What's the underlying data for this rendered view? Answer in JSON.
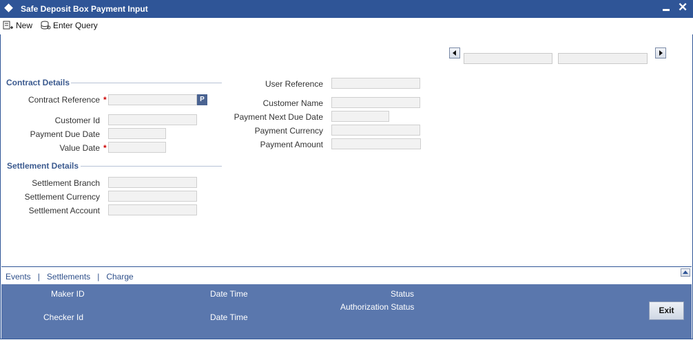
{
  "window": {
    "title": "Safe Deposit Box Payment Input"
  },
  "toolbar": {
    "new_label": "New",
    "enter_query_label": "Enter Query"
  },
  "contract": {
    "section_title": "Contract Details",
    "contract_reference_label": "Contract Reference",
    "customer_id_label": "Customer Id",
    "payment_due_date_label": "Payment Due Date",
    "value_date_label": "Value Date",
    "required_marker": "*",
    "pick_button": "P"
  },
  "settlement": {
    "section_title": "Settlement Details",
    "branch_label": "Settlement Branch",
    "currency_label": "Settlement Currency",
    "account_label": "Settlement Account"
  },
  "right": {
    "user_reference_label": "User Reference",
    "customer_name_label": "Customer Name",
    "payment_next_due_date_label": "Payment Next Due Date",
    "payment_currency_label": "Payment Currency",
    "payment_amount_label": "Payment Amount"
  },
  "links": {
    "events": "Events",
    "settlements": "Settlements",
    "charge": "Charge",
    "separator": "|"
  },
  "footer": {
    "maker_id": "Maker ID",
    "date_time_1": "Date Time",
    "status": "Status",
    "authorization_status": "Authorization Status",
    "checker_id": "Checker Id",
    "date_time_2": "Date Time",
    "exit": "Exit"
  }
}
